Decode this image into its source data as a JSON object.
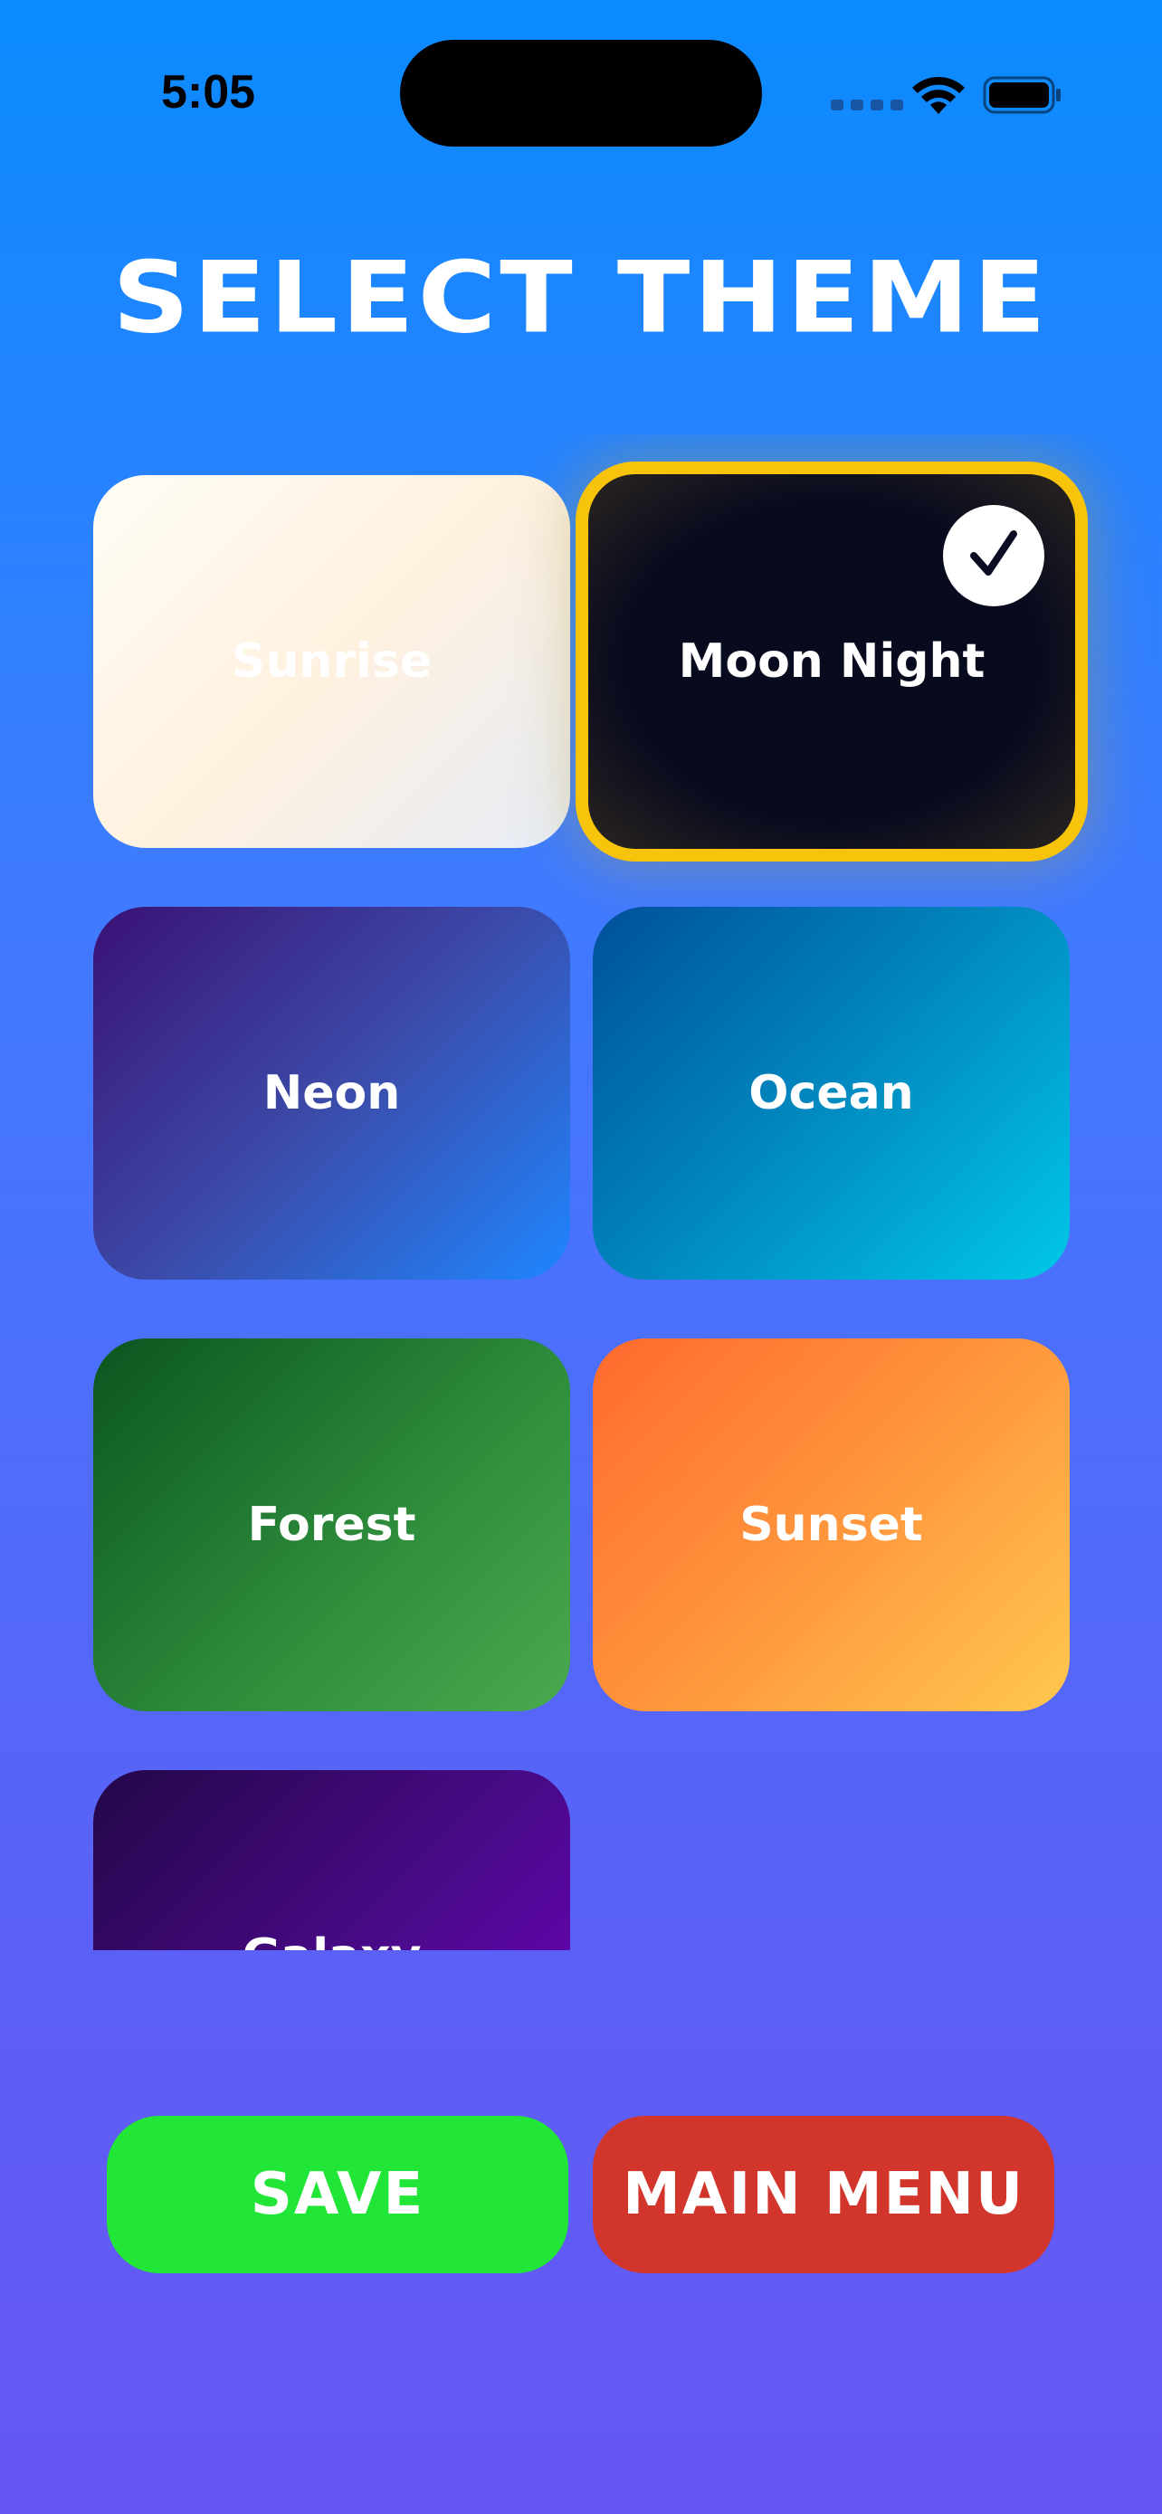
{
  "status_bar": {
    "time": "5:05"
  },
  "title": "SELECT THEME",
  "themes": [
    {
      "label": "Sunrise",
      "selected": false
    },
    {
      "label": "Moon Night",
      "selected": true
    },
    {
      "label": "Neon",
      "selected": false
    },
    {
      "label": "Ocean",
      "selected": false
    },
    {
      "label": "Forest",
      "selected": false
    },
    {
      "label": "Sunset",
      "selected": false
    },
    {
      "label": "Galaxy",
      "selected": false
    }
  ],
  "buttons": {
    "save": "SAVE",
    "main_menu": "MAIN MENU"
  },
  "colors": {
    "selected_border": "#f7c40b",
    "save_button": "#21e637",
    "main_menu_button": "#d2352c"
  }
}
